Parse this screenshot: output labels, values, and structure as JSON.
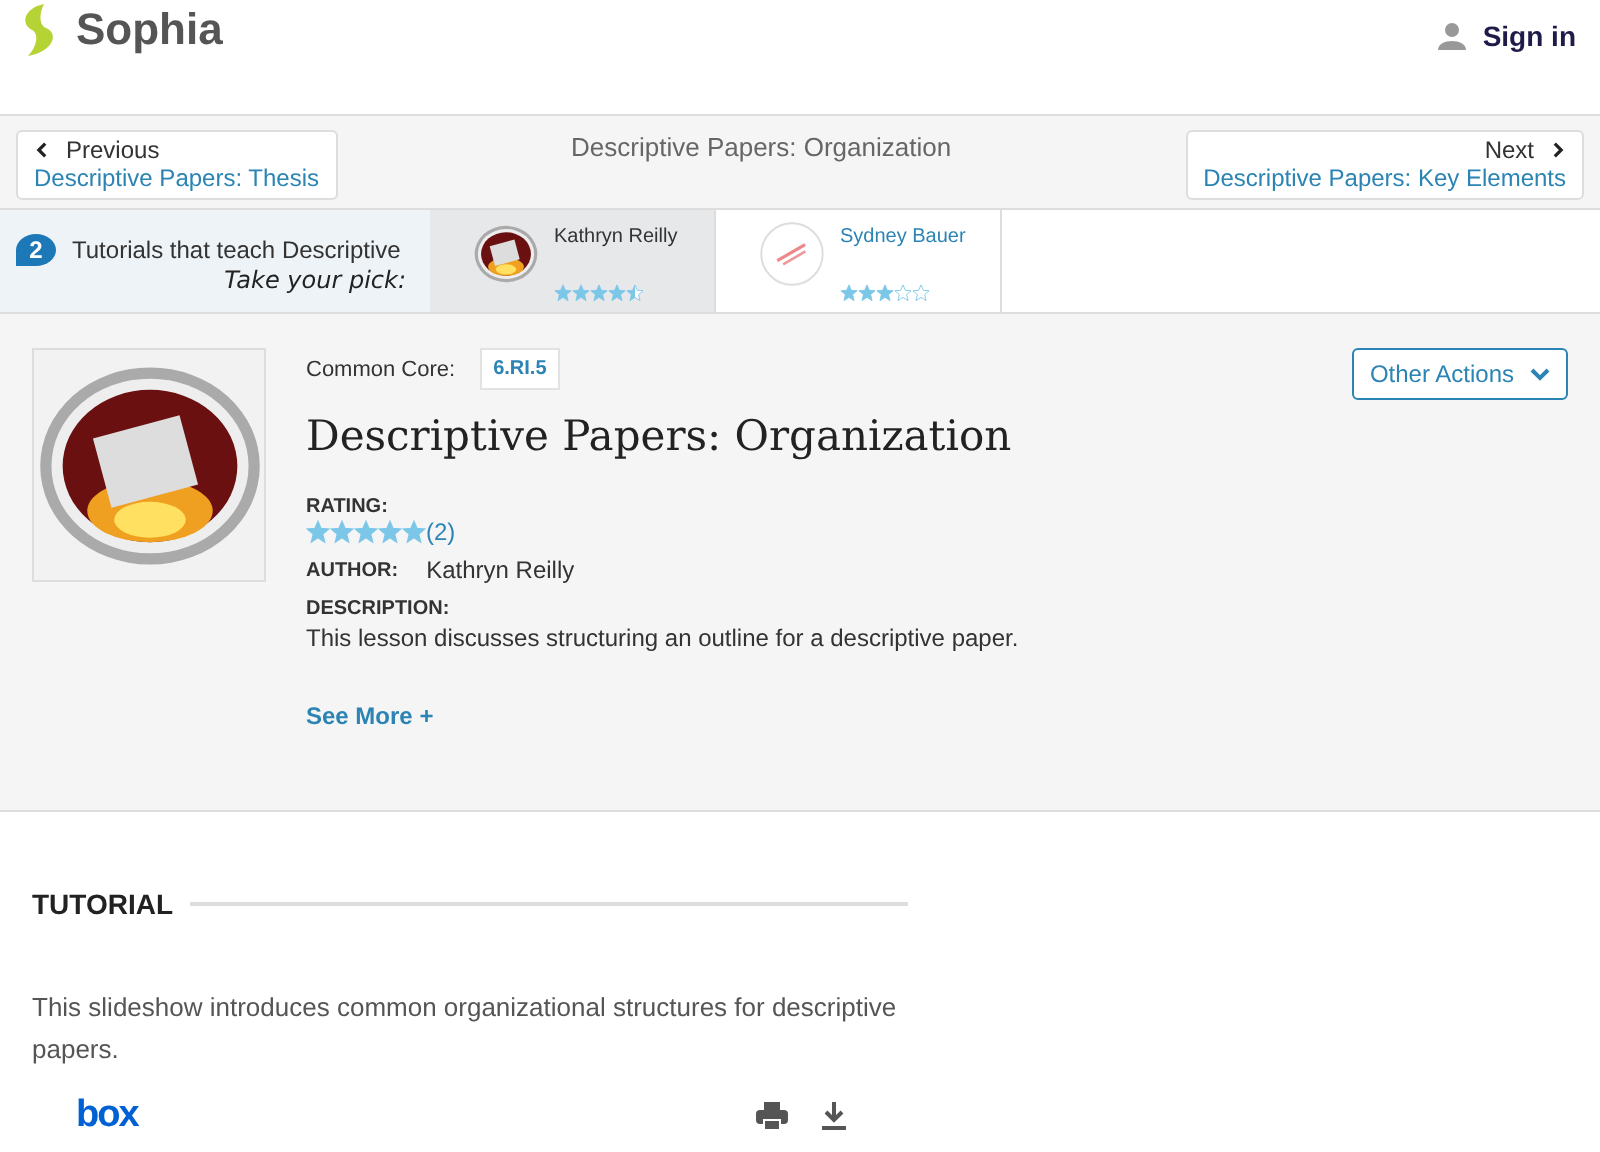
{
  "header": {
    "logo": "Sophia",
    "sign_in": "Sign in"
  },
  "nav": {
    "previous": {
      "label": "Previous",
      "title": "Descriptive Papers: Thesis"
    },
    "current": "Descriptive Papers: Organization",
    "next": {
      "label": "Next",
      "title": "Descriptive Papers: Key Elements"
    }
  },
  "tutorials_strip": {
    "count": "2",
    "text": "Tutorials that teach Descriptive",
    "pick": "Take your pick:",
    "items": [
      {
        "author": "Kathryn Reilly",
        "stars": 4.5,
        "selected": true
      },
      {
        "author": "Sydney Bauer",
        "stars": 3,
        "selected": false
      }
    ]
  },
  "lesson": {
    "common_core_label": "Common Core:",
    "standard": "6.RI.5",
    "title": "Descriptive Papers: Organization",
    "other_actions": "Other Actions",
    "rating_label": "RATING:",
    "stars": 5,
    "rating_count": "(2)",
    "author_label": "AUTHOR:",
    "author": "Kathryn Reilly",
    "description_label": "DESCRIPTION:",
    "description": "This lesson discusses structuring an outline for a descriptive paper.",
    "see_more": "See More +"
  },
  "tutorial": {
    "heading": "TUTORIAL",
    "description": "This slideshow introduces common organizational structures for descriptive papers.",
    "viewer_logo": "box"
  }
}
